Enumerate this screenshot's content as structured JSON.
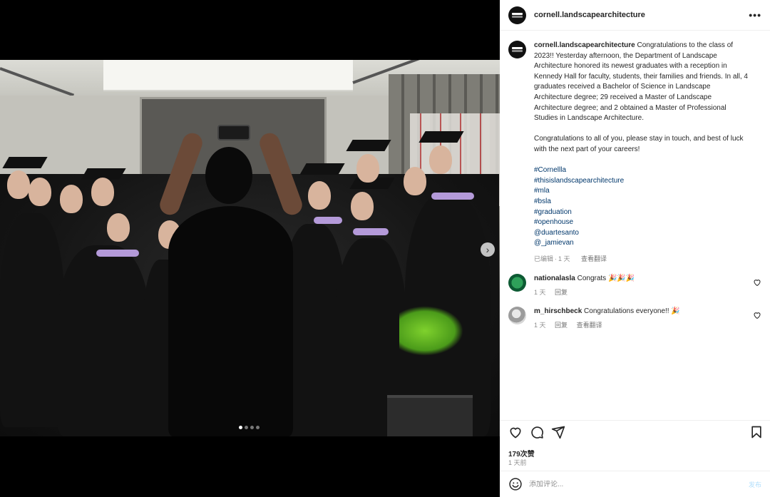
{
  "post": {
    "username": "cornell.landscapearchitecture",
    "more_icon": "more-horizontal-icon",
    "carousel": {
      "current": 1,
      "total": 4
    }
  },
  "caption": {
    "username": "cornell.landscapearchitecture",
    "text": "Congratulations to the class of 2023!! Yesterday afternoon, the Department of Landscape Architecture honored its newest graduates with a reception in Kennedy Hall for faculty, students, their families and friends. In all, 4 graduates received a Bachelor of Science in Landscape Architecture degree; 29 received a Master of Landscape Architecture degree; and 2 obtained a Master of Professional Studies in Landscape Architecture.",
    "text2": "Congratulations to all of you, please stay in touch, and best of luck with the next part of your careers!",
    "hashtags": [
      "#Cornellla",
      "#thisislandscapearchitecture",
      "#mla",
      "#bsla",
      "#graduation",
      "#openhouse",
      "@duartesanto",
      "@_jamievan"
    ],
    "edited": "已编辑",
    "separator": "·",
    "time": "1 天",
    "translate": "查看翻译"
  },
  "comments": [
    {
      "username": "nationalasla",
      "text": "Congrats",
      "emoji": "🎉🎉🎉",
      "time": "1 天",
      "reply": "回复",
      "translate": ""
    },
    {
      "username": "m_hirschbeck",
      "text": "Congratulations everyone!!",
      "emoji": "🎉",
      "time": "1 天",
      "reply": "回复",
      "translate": "查看翻译"
    }
  ],
  "actions": {
    "likes": "179次赞",
    "time": "1 天前"
  },
  "comment_box": {
    "placeholder": "添加评论...",
    "post_label": "发布"
  }
}
